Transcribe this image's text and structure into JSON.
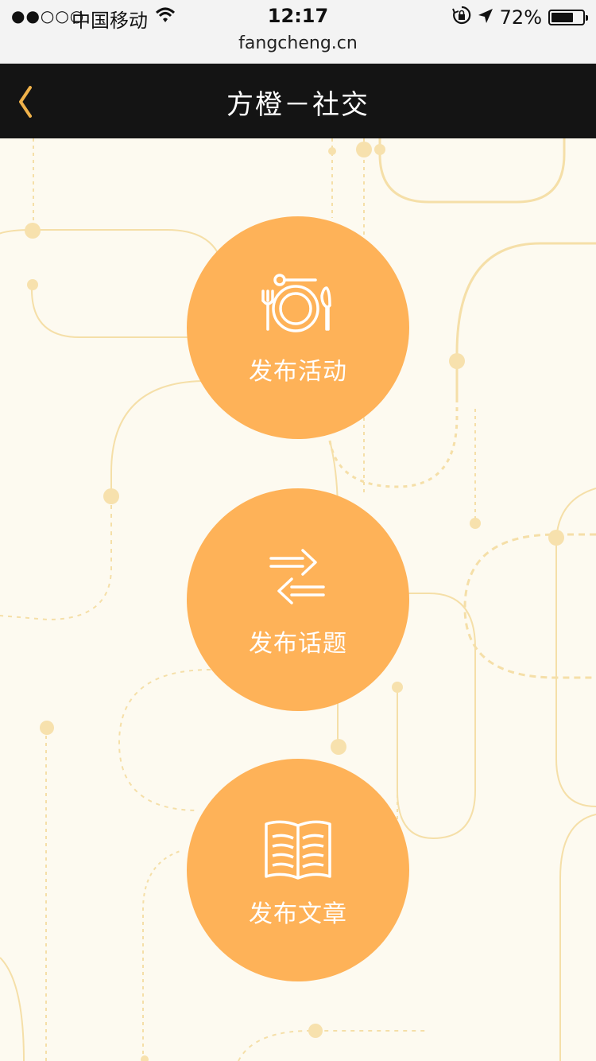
{
  "status_bar": {
    "signal": "●●○○○",
    "carrier": "中国移动",
    "time": "12:17",
    "url": "fangcheng.cn",
    "battery": "72%",
    "battery_level": 0.72
  },
  "nav": {
    "title": "方橙－社交"
  },
  "actions": [
    {
      "label": "发布活动",
      "icon": "dining-plate-icon"
    },
    {
      "label": "发布话题",
      "icon": "exchange-arrows-icon"
    },
    {
      "label": "发布文章",
      "icon": "open-book-icon"
    }
  ],
  "colors": {
    "accent": "#feb258",
    "background": "#fdfaf0",
    "nav_bg": "#141414",
    "back_arrow": "#f0b24a",
    "decor_line": "#f5dfa8"
  }
}
